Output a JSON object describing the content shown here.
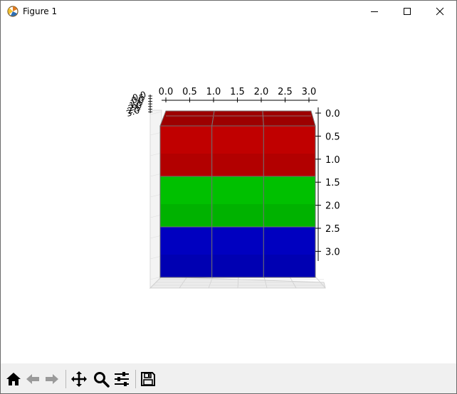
{
  "window": {
    "title": "Figure 1",
    "controls": [
      "minimize",
      "maximize",
      "close"
    ]
  },
  "toolbar": {
    "tools": [
      {
        "name": "home-icon",
        "label": "Home"
      },
      {
        "name": "back-icon",
        "label": "Back"
      },
      {
        "name": "forward-icon",
        "label": "Forward"
      },
      {
        "name": "pan-icon",
        "label": "Pan"
      },
      {
        "name": "zoom-icon",
        "label": "Zoom"
      },
      {
        "name": "subplots-icon",
        "label": "Configure subplots"
      },
      {
        "name": "save-icon",
        "label": "Save"
      }
    ]
  },
  "chart_data": {
    "type": "3d-voxels",
    "x_ticks": [
      "0.0",
      "0.5",
      "1.0",
      "1.5",
      "2.0",
      "2.5",
      "3.0"
    ],
    "z_ticks": [
      "0.0",
      "0.5",
      "1.0",
      "1.5",
      "2.0",
      "2.5",
      "3.0"
    ],
    "y_ticks": [
      "0.0",
      "0.5",
      "1.0",
      "1.5",
      "2.0",
      "2.5",
      "3.0"
    ],
    "grid": true,
    "voxels": {
      "columns": 3,
      "layers": [
        {
          "level": "top",
          "color": "#c00000"
        },
        {
          "level": "middle",
          "color": "#00c000"
        },
        {
          "level": "bottom",
          "color": "#0000c0"
        }
      ]
    }
  }
}
